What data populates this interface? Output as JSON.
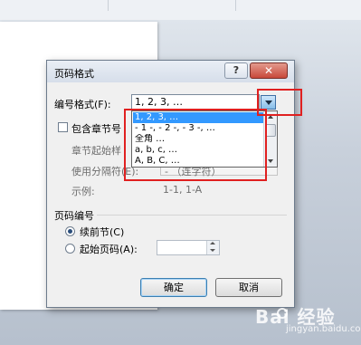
{
  "dialog": {
    "title": "页码格式",
    "help_label": "?",
    "close_label": "✕",
    "number_format": {
      "label": "编号格式(F):",
      "value": "1, 2, 3, …",
      "options": [
        "1, 2, 3, …",
        "- 1 -, - 2 -, - 3 -, …",
        "全角 …",
        "a, b, c, …",
        "A, B, C, …"
      ],
      "selected_index": 0
    },
    "include_chapter": {
      "label": "包含章节号",
      "checked": false
    },
    "chapter_style_label": "章节起始样",
    "separator": {
      "label": "使用分隔符(E):",
      "value": "- （连字符）"
    },
    "example": {
      "label": "示例:",
      "value": "1-1, 1-A"
    },
    "page_numbering": {
      "heading": "页码编号",
      "continue_label": "续前节(C)",
      "continue_selected": true,
      "start_at_label": "起始页码(A):",
      "start_at_selected": false,
      "start_at_value": ""
    },
    "ok_label": "确定",
    "cancel_label": "取消"
  },
  "watermark": {
    "brand": "Bai 经验",
    "url": "jingyan.baidu.com"
  },
  "colors": {
    "highlight_box": "#e02020",
    "selection": "#3399ff"
  }
}
